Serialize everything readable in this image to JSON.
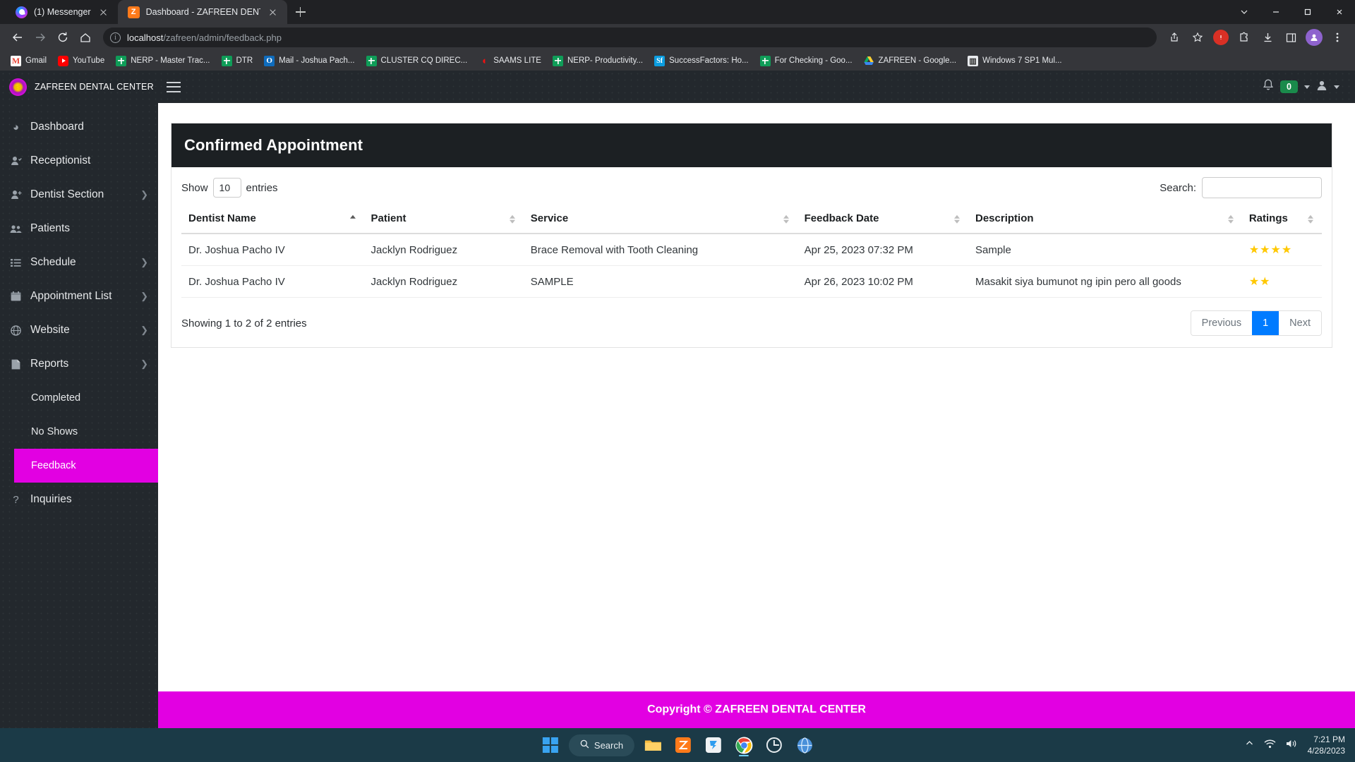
{
  "browser": {
    "tabs": [
      {
        "title": "(1) Messenger",
        "favicon": "messenger-icon",
        "active": false
      },
      {
        "title": "Dashboard - ZAFREEN DENTAL C",
        "favicon": "zafreen-icon",
        "active": true
      }
    ],
    "omnibox": {
      "url_bold": "localhost",
      "url_rest": "/zafreen/admin/feedback.php"
    },
    "bookmarks": [
      {
        "label": "Gmail",
        "icon": "gmail-icon"
      },
      {
        "label": "YouTube",
        "icon": "youtube-icon"
      },
      {
        "label": "NERP - Master Trac...",
        "icon": "google-sheets-icon"
      },
      {
        "label": "DTR",
        "icon": "google-sheets-icon"
      },
      {
        "label": "Mail - Joshua Pach...",
        "icon": "outlook-icon"
      },
      {
        "label": "CLUSTER CQ DIREC...",
        "icon": "google-sheets-icon"
      },
      {
        "label": "SAAMS LITE",
        "icon": "saams-icon"
      },
      {
        "label": "NERP- Productivity...",
        "icon": "google-sheets-icon"
      },
      {
        "label": "SuccessFactors: Ho...",
        "icon": "successfactors-icon"
      },
      {
        "label": "For Checking - Goo...",
        "icon": "google-sheets-icon"
      },
      {
        "label": "ZAFREEN - Google...",
        "icon": "google-drive-icon"
      },
      {
        "label": "Windows 7 SP1 Mul...",
        "icon": "archive-icon"
      }
    ]
  },
  "app": {
    "brand": "ZAFREEN DENTAL CENTER",
    "topbar": {
      "notification_count": "0"
    },
    "sidebar": {
      "items": [
        {
          "label": "Dashboard",
          "icon": "dashboard-icon",
          "chevron": false,
          "sub": false,
          "active": false
        },
        {
          "label": "Receptionist",
          "icon": "user-check-icon",
          "chevron": false,
          "sub": false,
          "active": false
        },
        {
          "label": "Dentist Section",
          "icon": "user-plus-icon",
          "chevron": true,
          "sub": false,
          "active": false
        },
        {
          "label": "Patients",
          "icon": "users-icon",
          "chevron": false,
          "sub": false,
          "active": false
        },
        {
          "label": "Schedule",
          "icon": "list-icon",
          "chevron": true,
          "sub": false,
          "active": false
        },
        {
          "label": "Appointment List",
          "icon": "calendar-icon",
          "chevron": true,
          "sub": false,
          "active": false
        },
        {
          "label": "Website",
          "icon": "globe-icon",
          "chevron": true,
          "sub": false,
          "active": false
        },
        {
          "label": "Reports",
          "icon": "file-icon",
          "chevron": true,
          "sub": false,
          "active": false
        },
        {
          "label": "Completed",
          "icon": "",
          "chevron": false,
          "sub": true,
          "active": false
        },
        {
          "label": "No Shows",
          "icon": "",
          "chevron": false,
          "sub": true,
          "active": false
        },
        {
          "label": "Feedback",
          "icon": "",
          "chevron": false,
          "sub": true,
          "active": true
        },
        {
          "label": "Inquiries",
          "icon": "question-icon",
          "chevron": false,
          "sub": false,
          "active": false
        }
      ]
    },
    "card": {
      "title": "Confirmed Appointment",
      "datatable": {
        "show_label": "Show",
        "entries_label": "entries",
        "page_length": "10",
        "search_label": "Search:",
        "search_value": "",
        "search_placeholder": "",
        "columns": [
          {
            "label": "Dentist Name",
            "sort": "asc"
          },
          {
            "label": "Patient",
            "sort": "none"
          },
          {
            "label": "Service",
            "sort": "none"
          },
          {
            "label": "Feedback Date",
            "sort": "none"
          },
          {
            "label": "Description",
            "sort": "none"
          },
          {
            "label": "Ratings",
            "sort": "none"
          }
        ],
        "rows": [
          {
            "dentist": "Dr. Joshua Pacho IV",
            "patient": "Jacklyn Rodriguez",
            "service": "Brace Removal with Tooth Cleaning",
            "feedback_date": "Apr 25, 2023 07:32 PM",
            "description": "Sample",
            "rating": 4,
            "stars": "★★★★"
          },
          {
            "dentist": "Dr. Joshua Pacho IV",
            "patient": "Jacklyn Rodriguez",
            "service": "SAMPLE",
            "feedback_date": "Apr 26, 2023 10:02 PM",
            "description": "Masakit siya bumunot ng ipin pero all goods",
            "rating": 2,
            "stars": "★★"
          }
        ],
        "info": "Showing 1 to 2 of 2 entries",
        "pagination": {
          "previous": "Previous",
          "pages": [
            "1"
          ],
          "next": "Next",
          "current": "1"
        }
      }
    },
    "footer": "Copyright © ZAFREEN DENTAL CENTER",
    "colors": {
      "accent": "#e200e2",
      "sidebar_bg": "#23282d",
      "card_header_bg": "#1c2023",
      "page_active": "#007bff",
      "star": "#ffc800",
      "badge": "#1a8a4b"
    }
  },
  "taskbar": {
    "search_label": "Search",
    "apps": [
      "file-explorer-icon",
      "zafreen-app-icon",
      "editor-icon",
      "chrome-icon",
      "recorder-icon",
      "browser-icon"
    ],
    "clock": {
      "time": "7:21 PM",
      "date": "4/28/2023"
    }
  }
}
